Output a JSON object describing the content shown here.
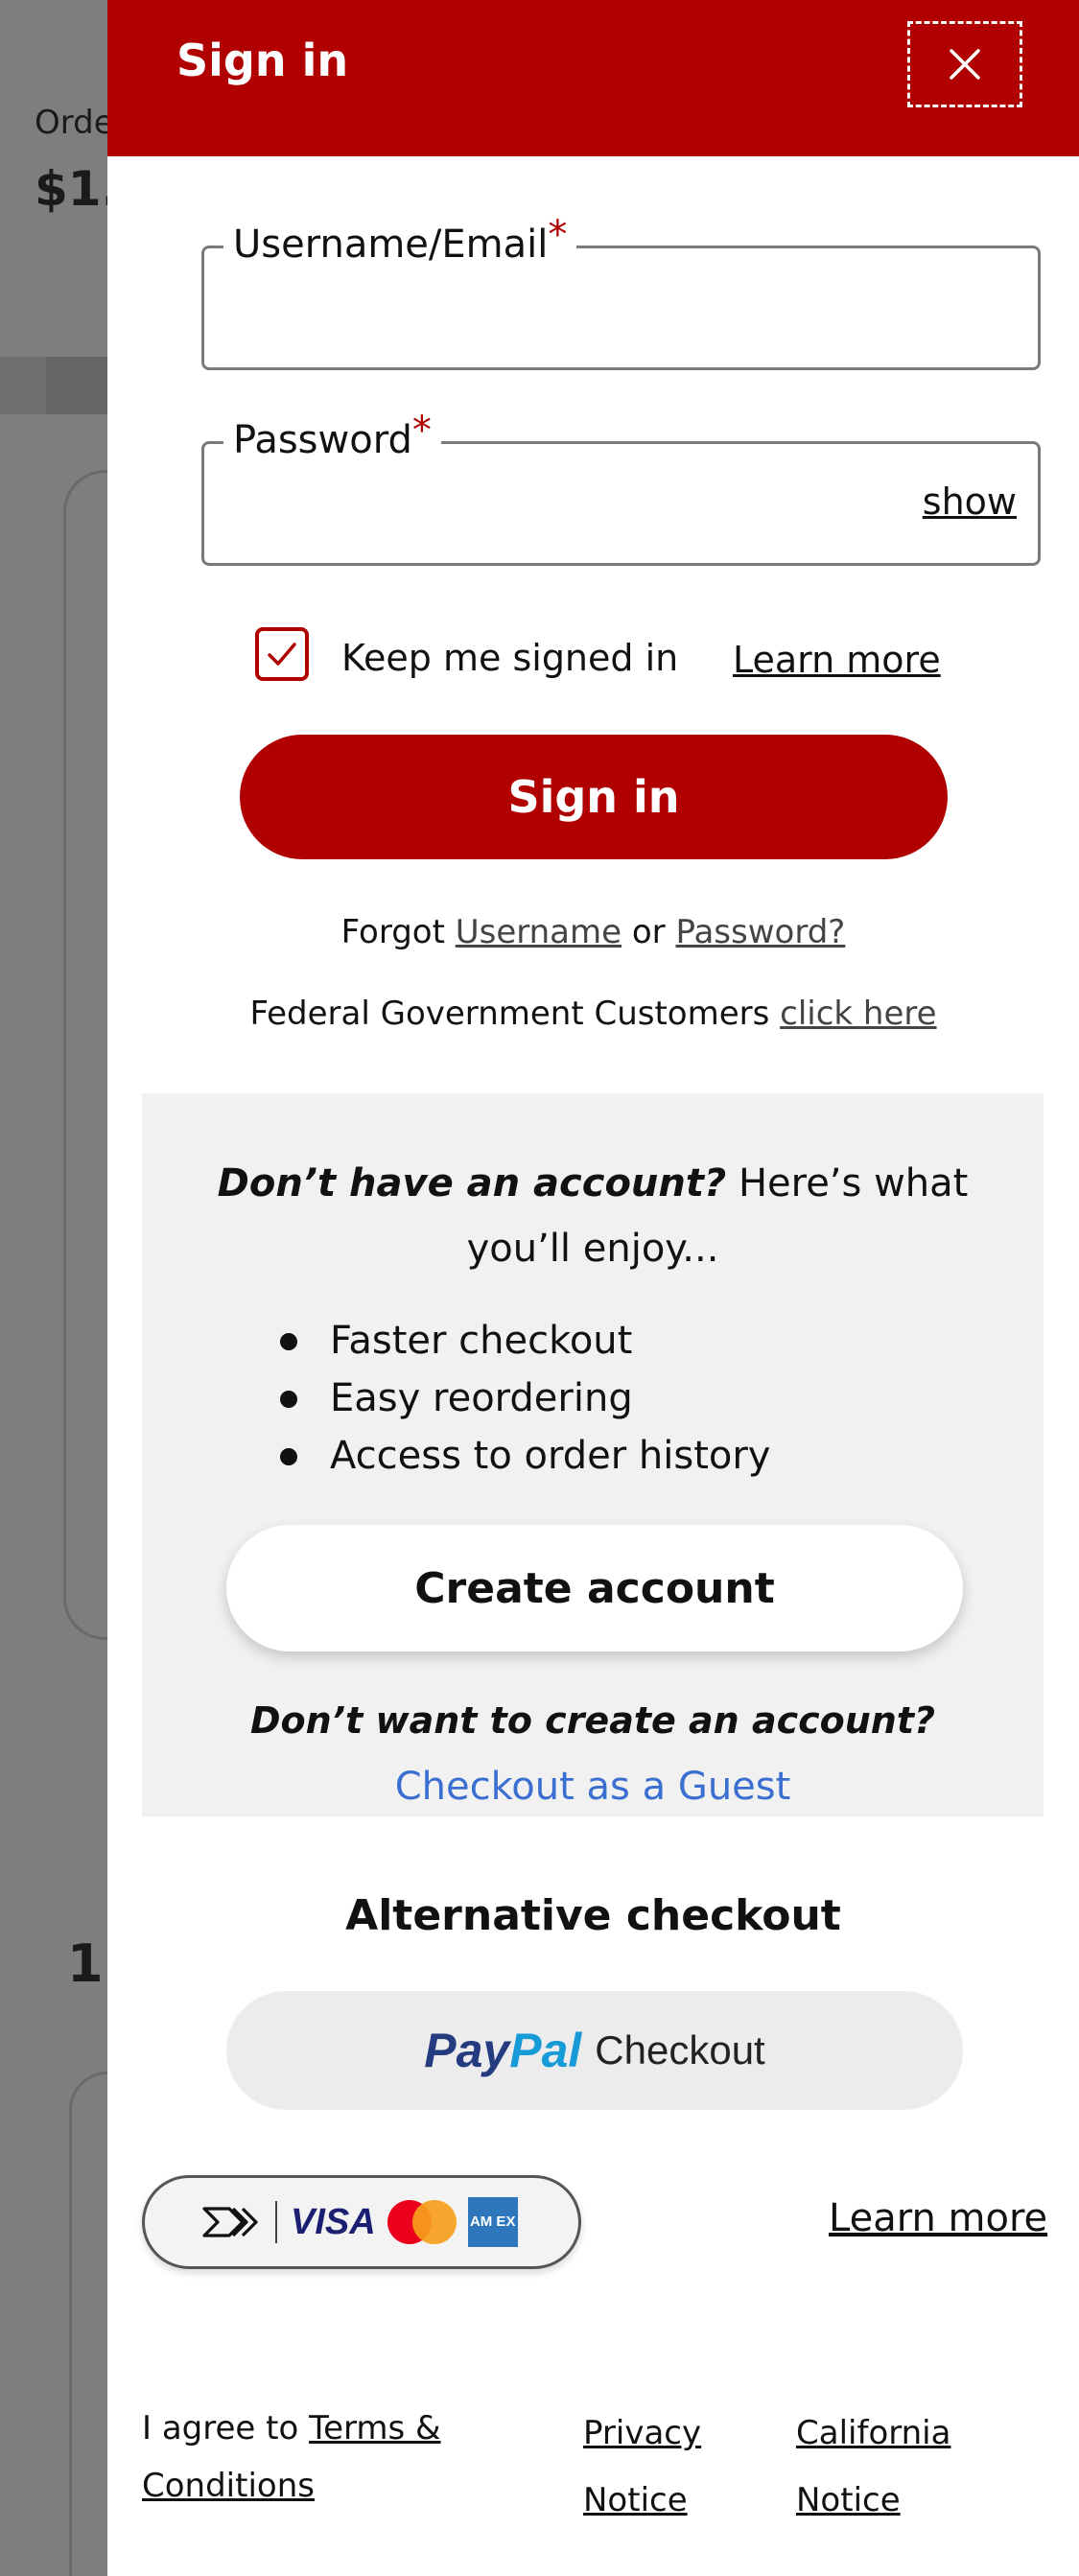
{
  "background": {
    "order_label": "Orde",
    "order_total": "$1.",
    "item_count": "1"
  },
  "header": {
    "title": "Sign in",
    "close_icon": "close-icon"
  },
  "form": {
    "username_label": "Username/Email",
    "username_value": "",
    "password_label": "Password",
    "password_value": "",
    "required_marker": "*",
    "show_label": "show",
    "keep_signed_in_label": "Keep me signed in",
    "keep_signed_in_checked": true,
    "learn_more_label": "Learn more",
    "sign_in_button": "Sign in",
    "forgot_prefix": "Forgot",
    "forgot_username": "Username",
    "forgot_or": "or",
    "forgot_password": "Password?",
    "federal_text": "Federal Government Customers",
    "federal_link": "click here"
  },
  "promo": {
    "question": "Don’t have an account?",
    "rest": "Here’s what you’ll enjoy...",
    "benefits": [
      "Faster checkout",
      "Easy reordering",
      "Access to order history"
    ],
    "create_account_button": "Create account",
    "no_account_question": "Don’t want to create an account?",
    "guest_link": "Checkout as a Guest"
  },
  "alternative": {
    "title": "Alternative checkout",
    "paypal_pay": "Pay",
    "paypal_pal": "Pal",
    "paypal_checkout": "Checkout",
    "card_brand_visa": "VISA",
    "card_brand_amex": "AM EX",
    "learn_more_label": "Learn more"
  },
  "footer": {
    "agree_prefix": "I agree to",
    "terms_link": "Terms & Conditions",
    "privacy_link": "Privacy Notice",
    "california_link": "California Notice"
  },
  "colors": {
    "brand_red": "#b00000",
    "link_blue": "#3a6fd1",
    "panel_bg": "#ffffff",
    "promo_bg": "#f1f1f1"
  }
}
